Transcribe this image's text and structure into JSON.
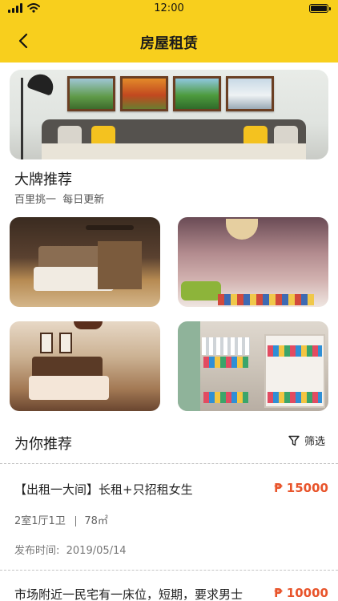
{
  "status_bar": {
    "time": "12:00"
  },
  "header": {
    "title": "房屋租赁"
  },
  "brand_section": {
    "title": "大牌推荐",
    "subtitle": "百里挑一  每日更新"
  },
  "recommend_section": {
    "title": "为你推荐",
    "filter_label": "筛选"
  },
  "listings": [
    {
      "title": "【出租一大间】长租+只招租女生",
      "price": "₱ 15000",
      "layout": "2室1厅1卫",
      "area": "78㎡",
      "date": "发布时间:  2019/05/14"
    },
    {
      "title": "市场附近一民宅有一床位，短期，要求男士",
      "price": "₱ 10000"
    }
  ],
  "colors": {
    "header": "#f8cf1d",
    "price": "#e8542b"
  }
}
